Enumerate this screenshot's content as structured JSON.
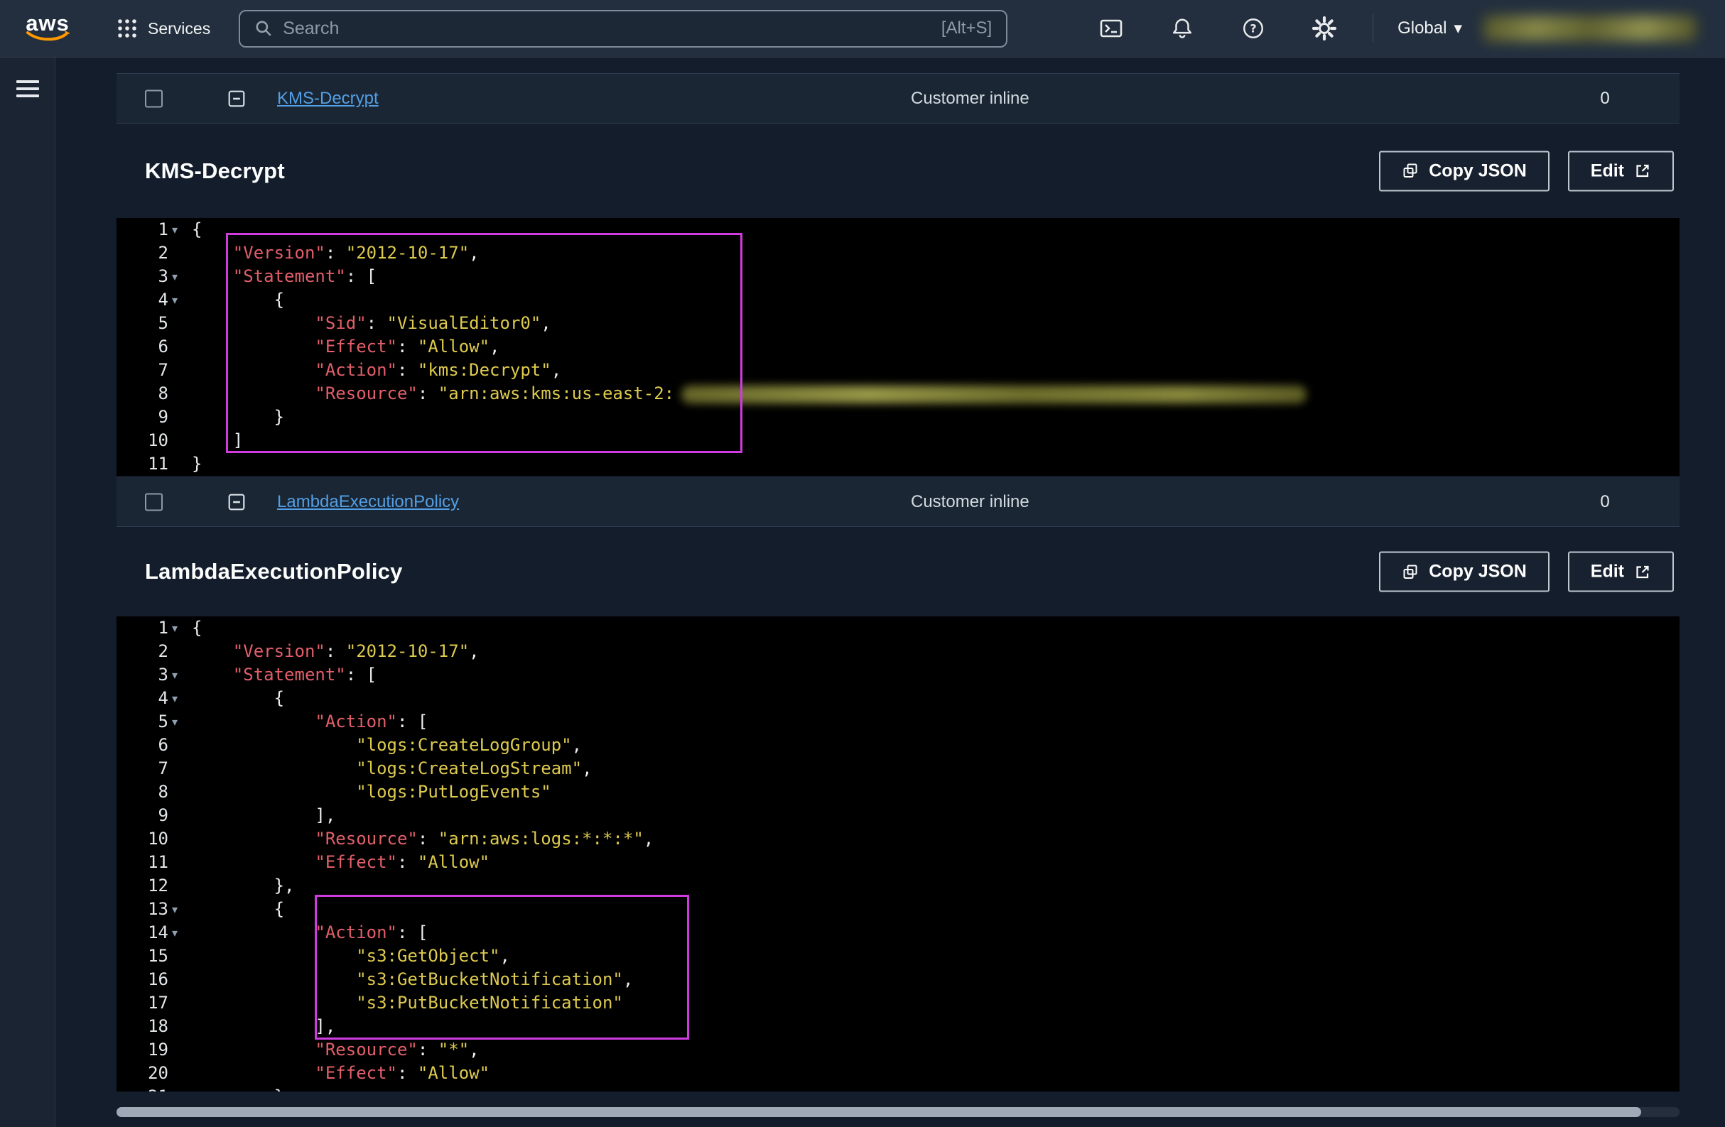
{
  "app": {
    "title": "AWS Console - IAM inline policies (dark theme)"
  },
  "colors": {
    "header_bg": "#232f3e",
    "page_bg": "#141d2b",
    "row_bg": "#1a2634",
    "editor_bg": "#000000",
    "link_blue": "#539fe5",
    "aws_orange": "#ff9900",
    "code_key": "#e25f6a",
    "code_string": "#ddca4e",
    "highlight_box": "#d03be0"
  },
  "icons": {
    "logo": "aws-smile",
    "services": "grid-3x3-dots",
    "search": "magnifier",
    "cloudshell": "terminal-window",
    "notifications": "bell",
    "help": "question-circle",
    "settings": "gear",
    "region_caret": "caret-down",
    "menu": "hamburger",
    "collapse_row": "minus-square",
    "copy": "two-overlapping-squares",
    "edit": "external-link",
    "fold": "triangle-down"
  },
  "redactions": {
    "header_account": "blurred",
    "kms_resource_arn_suffix": "blurred"
  },
  "header": {
    "logo_text": "aws",
    "services_label": "Services",
    "search_placeholder": "Search",
    "search_shortcut": "[Alt+S]",
    "region_label": "Global"
  },
  "policies": [
    {
      "row": {
        "name": "KMS-Decrypt",
        "type": "Customer inline",
        "count": "0"
      },
      "panel": {
        "title": "KMS-Decrypt",
        "copy_label": "Copy JSON",
        "edit_label": "Edit",
        "code": {
          "lines": [
            {
              "fold": true,
              "tokens": [
                [
                  "p",
                  "{"
                ]
              ]
            },
            {
              "tokens": [
                [
                  "p",
                  "    "
                ],
                [
                  "k",
                  "\"Version\""
                ],
                [
                  "p",
                  ": "
                ],
                [
                  "s",
                  "\"2012-10-17\""
                ],
                [
                  "p",
                  ","
                ]
              ]
            },
            {
              "fold": true,
              "tokens": [
                [
                  "p",
                  "    "
                ],
                [
                  "k",
                  "\"Statement\""
                ],
                [
                  "p",
                  ": ["
                ]
              ]
            },
            {
              "fold": true,
              "tokens": [
                [
                  "p",
                  "        {"
                ]
              ]
            },
            {
              "tokens": [
                [
                  "p",
                  "            "
                ],
                [
                  "k",
                  "\"Sid\""
                ],
                [
                  "p",
                  ": "
                ],
                [
                  "s",
                  "\"VisualEditor0\""
                ],
                [
                  "p",
                  ","
                ]
              ]
            },
            {
              "tokens": [
                [
                  "p",
                  "            "
                ],
                [
                  "k",
                  "\"Effect\""
                ],
                [
                  "p",
                  ": "
                ],
                [
                  "s",
                  "\"Allow\""
                ],
                [
                  "p",
                  ","
                ]
              ]
            },
            {
              "tokens": [
                [
                  "p",
                  "            "
                ],
                [
                  "k",
                  "\"Action\""
                ],
                [
                  "p",
                  ": "
                ],
                [
                  "s",
                  "\"kms:Decrypt\""
                ],
                [
                  "p",
                  ","
                ]
              ]
            },
            {
              "tokens": [
                [
                  "p",
                  "            "
                ],
                [
                  "k",
                  "\"Resource\""
                ],
                [
                  "p",
                  ": "
                ],
                [
                  "s",
                  "\"arn:aws:kms:us-east-2:"
                ],
                [
                  "blur",
                  "redacted"
                ]
              ]
            },
            {
              "tokens": [
                [
                  "p",
                  "        }"
                ]
              ]
            },
            {
              "tokens": [
                [
                  "p",
                  "    ]"
                ]
              ]
            },
            {
              "tokens": [
                [
                  "p",
                  "}"
                ]
              ]
            }
          ]
        }
      }
    },
    {
      "row": {
        "name": "LambdaExecutionPolicy",
        "type": "Customer inline",
        "count": "0"
      },
      "panel": {
        "title": "LambdaExecutionPolicy",
        "copy_label": "Copy JSON",
        "edit_label": "Edit",
        "code": {
          "lines": [
            {
              "fold": true,
              "tokens": [
                [
                  "p",
                  "{"
                ]
              ]
            },
            {
              "tokens": [
                [
                  "p",
                  "    "
                ],
                [
                  "k",
                  "\"Version\""
                ],
                [
                  "p",
                  ": "
                ],
                [
                  "s",
                  "\"2012-10-17\""
                ],
                [
                  "p",
                  ","
                ]
              ]
            },
            {
              "fold": true,
              "tokens": [
                [
                  "p",
                  "    "
                ],
                [
                  "k",
                  "\"Statement\""
                ],
                [
                  "p",
                  ": ["
                ]
              ]
            },
            {
              "fold": true,
              "tokens": [
                [
                  "p",
                  "        {"
                ]
              ]
            },
            {
              "fold": true,
              "tokens": [
                [
                  "p",
                  "            "
                ],
                [
                  "k",
                  "\"Action\""
                ],
                [
                  "p",
                  ": ["
                ]
              ]
            },
            {
              "tokens": [
                [
                  "p",
                  "                "
                ],
                [
                  "s",
                  "\"logs:CreateLogGroup\""
                ],
                [
                  "p",
                  ","
                ]
              ]
            },
            {
              "tokens": [
                [
                  "p",
                  "                "
                ],
                [
                  "s",
                  "\"logs:CreateLogStream\""
                ],
                [
                  "p",
                  ","
                ]
              ]
            },
            {
              "tokens": [
                [
                  "p",
                  "                "
                ],
                [
                  "s",
                  "\"logs:PutLogEvents\""
                ]
              ]
            },
            {
              "tokens": [
                [
                  "p",
                  "            ],"
                ]
              ]
            },
            {
              "tokens": [
                [
                  "p",
                  "            "
                ],
                [
                  "k",
                  "\"Resource\""
                ],
                [
                  "p",
                  ": "
                ],
                [
                  "s",
                  "\"arn:aws:logs:*:*:*\""
                ],
                [
                  "p",
                  ","
                ]
              ]
            },
            {
              "tokens": [
                [
                  "p",
                  "            "
                ],
                [
                  "k",
                  "\"Effect\""
                ],
                [
                  "p",
                  ": "
                ],
                [
                  "s",
                  "\"Allow\""
                ]
              ]
            },
            {
              "tokens": [
                [
                  "p",
                  "        },"
                ]
              ]
            },
            {
              "fold": true,
              "tokens": [
                [
                  "p",
                  "        {"
                ]
              ]
            },
            {
              "fold": true,
              "tokens": [
                [
                  "p",
                  "            "
                ],
                [
                  "k",
                  "\"Action\""
                ],
                [
                  "p",
                  ": ["
                ]
              ]
            },
            {
              "tokens": [
                [
                  "p",
                  "                "
                ],
                [
                  "s",
                  "\"s3:GetObject\""
                ],
                [
                  "p",
                  ","
                ]
              ]
            },
            {
              "tokens": [
                [
                  "p",
                  "                "
                ],
                [
                  "s",
                  "\"s3:GetBucketNotification\""
                ],
                [
                  "p",
                  ","
                ]
              ]
            },
            {
              "tokens": [
                [
                  "p",
                  "                "
                ],
                [
                  "s",
                  "\"s3:PutBucketNotification\""
                ]
              ]
            },
            {
              "tokens": [
                [
                  "p",
                  "            ],"
                ]
              ]
            },
            {
              "tokens": [
                [
                  "p",
                  "            "
                ],
                [
                  "k",
                  "\"Resource\""
                ],
                [
                  "p",
                  ": "
                ],
                [
                  "s",
                  "\"*\""
                ],
                [
                  "p",
                  ","
                ]
              ]
            },
            {
              "tokens": [
                [
                  "p",
                  "            "
                ],
                [
                  "k",
                  "\"Effect\""
                ],
                [
                  "p",
                  ": "
                ],
                [
                  "s",
                  "\"Allow\""
                ]
              ]
            },
            {
              "tokens": [
                [
                  "p",
                  "        },"
                ]
              ]
            }
          ]
        }
      }
    }
  ]
}
